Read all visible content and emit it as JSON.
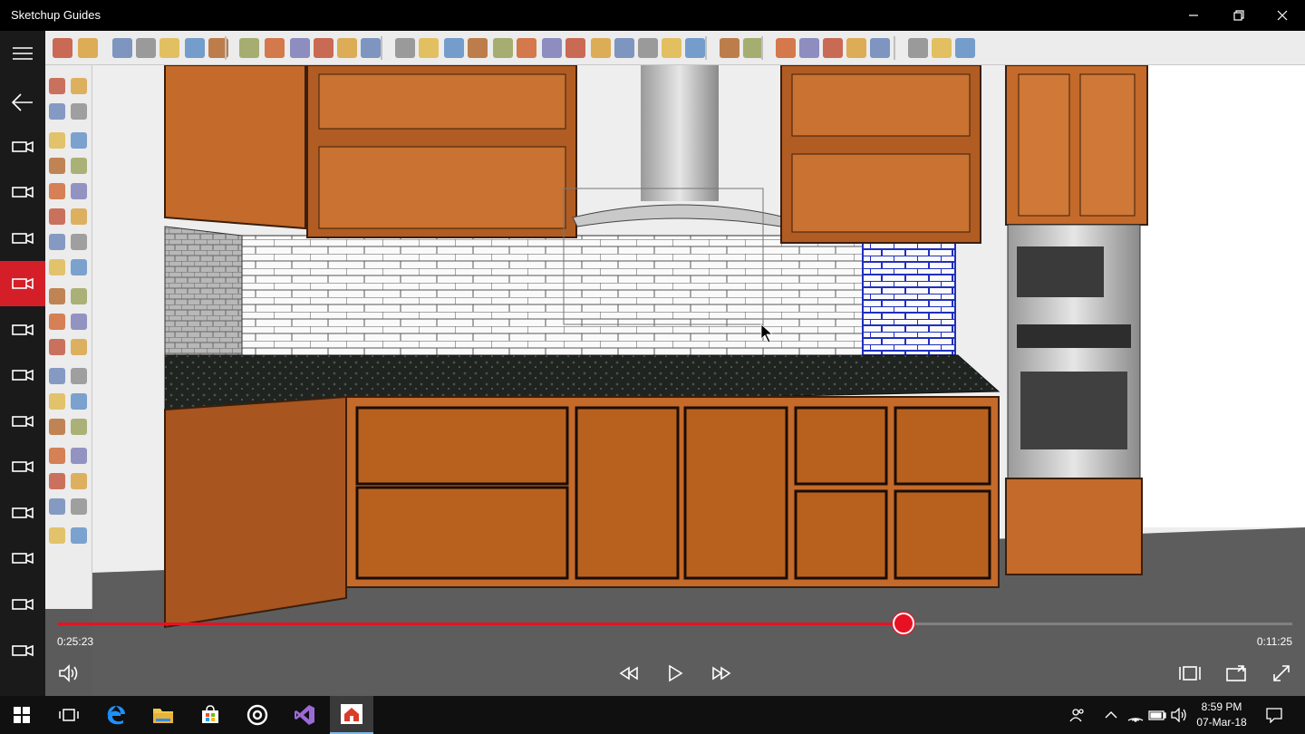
{
  "window": {
    "title": "Sketchup Guides",
    "controls": [
      "minimize-icon",
      "restore-icon",
      "close-icon"
    ]
  },
  "rail": {
    "items": [
      {
        "name": "menu",
        "icon": "hamburger-icon"
      },
      {
        "name": "back",
        "icon": "back-arrow-icon"
      },
      {
        "name": "video-1",
        "icon": "video-icon"
      },
      {
        "name": "video-2",
        "icon": "video-icon"
      },
      {
        "name": "video-3",
        "icon": "video-icon"
      },
      {
        "name": "video-4",
        "icon": "video-icon",
        "active": true
      },
      {
        "name": "video-5",
        "icon": "video-icon"
      },
      {
        "name": "video-6",
        "icon": "video-icon"
      },
      {
        "name": "video-7",
        "icon": "video-icon"
      },
      {
        "name": "video-8",
        "icon": "video-icon"
      },
      {
        "name": "video-9",
        "icon": "video-icon"
      },
      {
        "name": "video-10",
        "icon": "video-icon"
      },
      {
        "name": "video-11",
        "icon": "video-icon"
      }
    ]
  },
  "player": {
    "elapsed": "0:25:23",
    "remaining": "0:11:25",
    "progress": 0.685,
    "controls": [
      "volume-icon",
      "rewind-icon",
      "play-icon",
      "fast-forward-icon",
      "aspect-ratio-icon",
      "cast-icon",
      "fullscreen-icon"
    ]
  },
  "taskbar": {
    "apps": [
      "windows-start-icon",
      "task-view-icon",
      "edge-icon",
      "file-explorer-icon",
      "store-icon",
      "groove-icon",
      "visual-studio-icon",
      "sketchup-guides-icon"
    ],
    "active_app": "sketchup-guides-icon",
    "tray": [
      "people-icon",
      "chevron-up-icon",
      "wifi-icon",
      "battery-icon",
      "speaker-icon"
    ],
    "time": "8:59 PM",
    "date": "07-Mar-18",
    "notification_icon": "action-center-icon"
  },
  "colors": {
    "accent": "#e81123",
    "rail_active": "#d41f29",
    "cabinet": "#c46a2a",
    "backsplash_selected": "#1f2fbf"
  }
}
